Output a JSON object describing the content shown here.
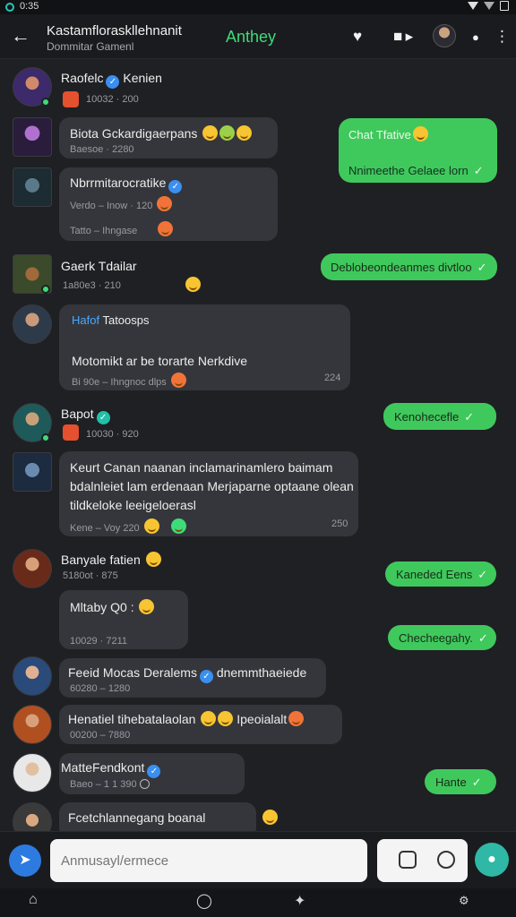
{
  "status": {
    "time": "0:35"
  },
  "header": {
    "title": "Kastamfloraskllehnanit",
    "subtitle": "Dommitar Gamenl",
    "app_name": "Anthey"
  },
  "messages": [
    {
      "name": "Raofelc",
      "name_suffix": "Kenien",
      "meta": "10032 · 200"
    },
    {
      "text": "Biota Gckardigaerpans",
      "meta": "Baesoe · 2280"
    },
    {
      "name": "Nbrrmitarocratike",
      "meta1": "Verdo – Inow · 120",
      "meta2": "Tatto – Ihngase"
    },
    {
      "name": "Gaerk Tdailar",
      "meta": "1a80e3 · 210"
    },
    {
      "label": "Hafof",
      "title": "Tatoosps",
      "text": "Motomikt ar be torarte Nerkdive",
      "meta": "Bi 90e – Ihngnoc dlps",
      "time": "224"
    },
    {
      "name": "Bapot",
      "meta": "10030 · 920"
    },
    {
      "lines": [
        "Keurt Canan naanan inclamarinamlero baimam",
        "bdalnleiet lam erdenaan Merjaparne optaane olean",
        "tildkeloke leeigeloerasl"
      ],
      "meta": "Kene – Voy 220",
      "time": "250"
    },
    {
      "name": "Banyale fatien",
      "meta": "5180ot · 875",
      "sub": "Mltaby Q0 :",
      "submeta": "10029 · 7211"
    },
    {
      "name": "Feeid Mocas Deralems",
      "name_suffix": "dnemmthaeiede",
      "meta": "60280 – 1280"
    },
    {
      "name": "Henatiel tihebatalaolan",
      "name_suffix": "Ipeoialalt",
      "meta": "00200 – 7880"
    },
    {
      "name": "MatteFendkont",
      "meta": "Baeo – 1 1 390"
    },
    {
      "name": "Fcetchlannegang boanal"
    }
  ],
  "sent": [
    {
      "title": "Chat Tfative",
      "text": "Nnimeethe Gelaee lorn"
    },
    {
      "text": "Deblobeondeanmes divtloo"
    },
    {
      "text": "Kenohecefle"
    },
    {
      "text": "Kaneded Eens"
    },
    {
      "text": "Checheegahy."
    },
    {
      "text": "Hante"
    }
  ],
  "composer": {
    "placeholder": "Anmusayl/ermece"
  },
  "colors": {
    "sent_bubble": "#3fc95c",
    "received_bubble": "#35363b",
    "background": "#1f2023",
    "accent": "#3ddc7a"
  }
}
